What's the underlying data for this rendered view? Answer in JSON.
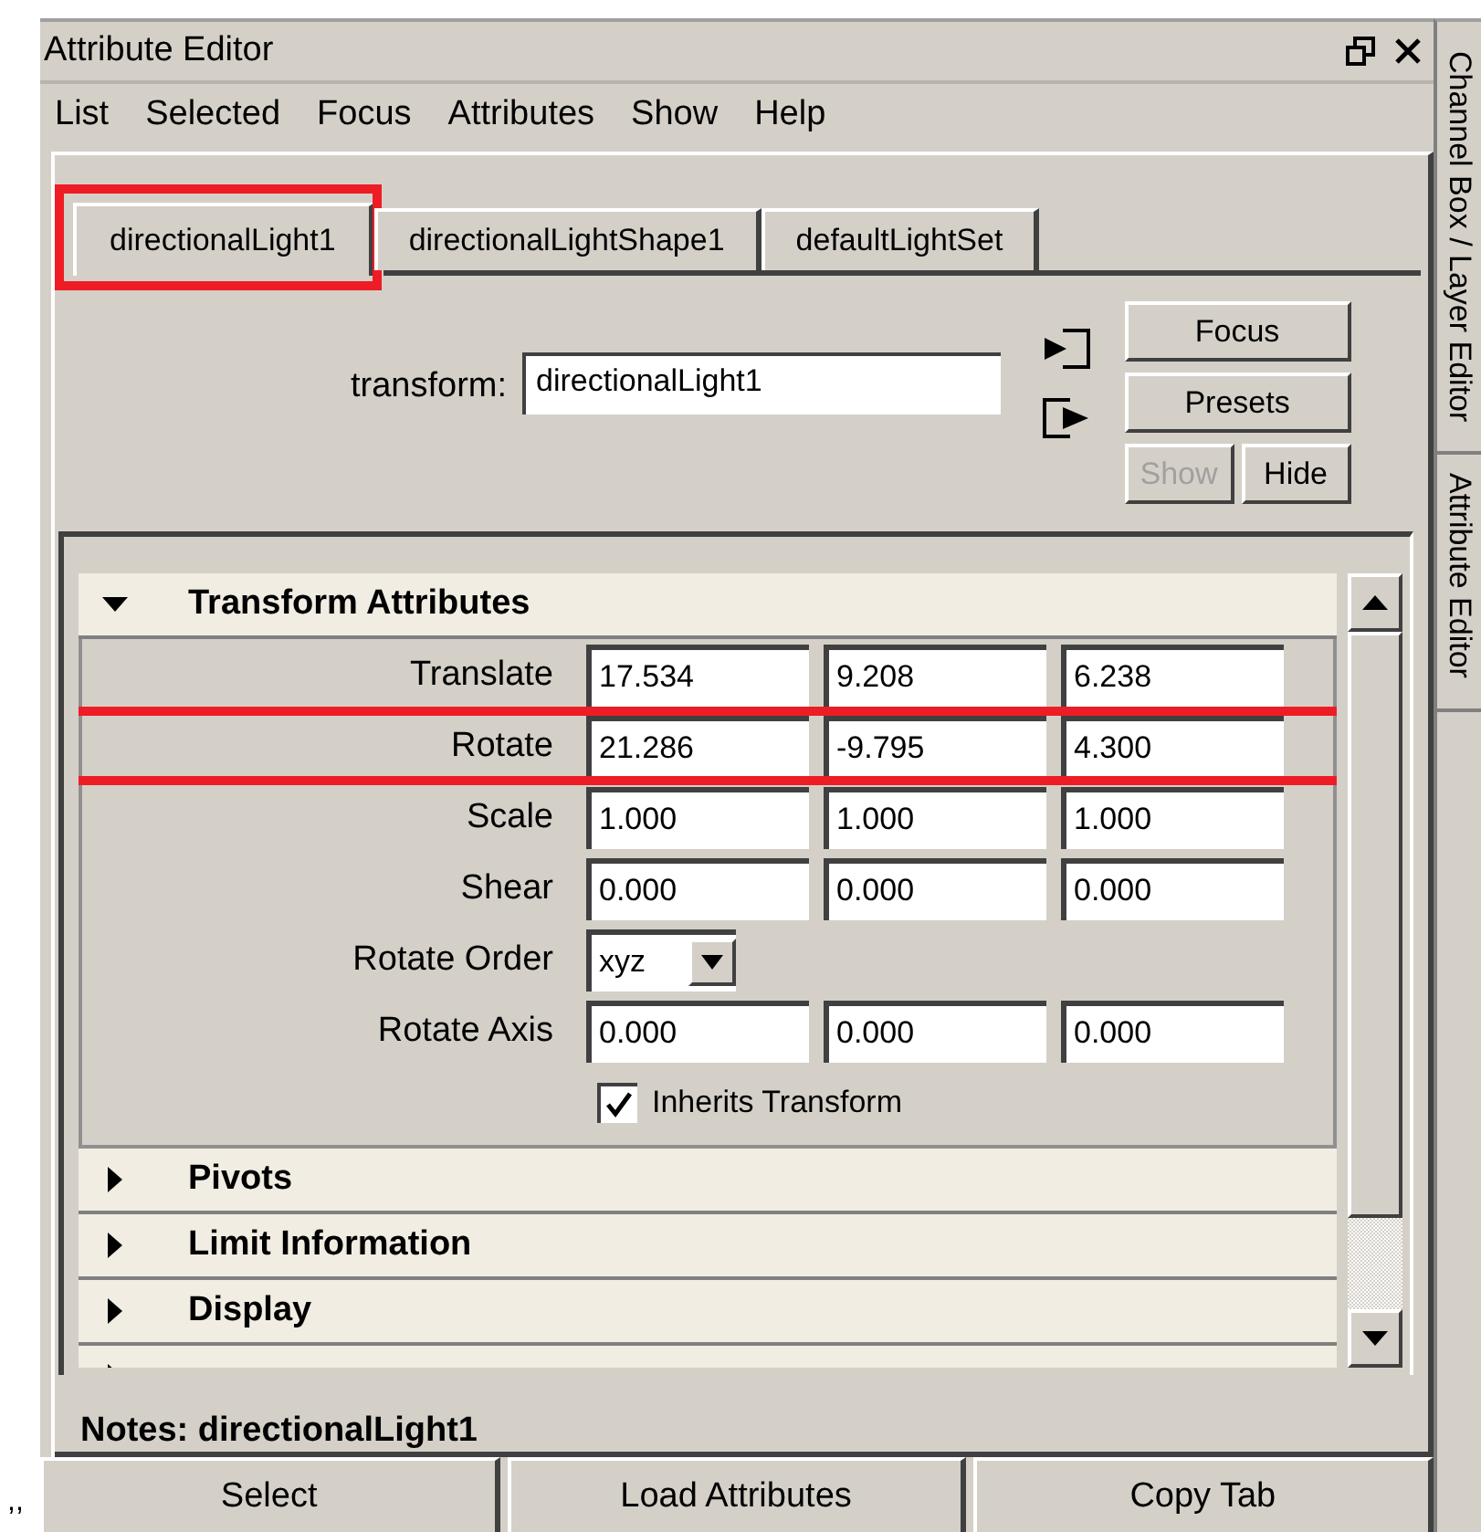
{
  "window": {
    "title": "Attribute Editor"
  },
  "menu": [
    "List",
    "Selected",
    "Focus",
    "Attributes",
    "Show",
    "Help"
  ],
  "tabs": [
    {
      "label": "directionalLight1",
      "selected": true,
      "highlighted": true
    },
    {
      "label": "directionalLightShape1",
      "selected": false,
      "highlighted": false
    },
    {
      "label": "defaultLightSet",
      "selected": false,
      "highlighted": false
    }
  ],
  "node": {
    "label": "transform:",
    "value": "directionalLight1"
  },
  "side_buttons": [
    {
      "label": "Focus",
      "disabled": false
    },
    {
      "label": "Presets",
      "disabled": false
    },
    {
      "label": "Show",
      "disabled": true
    },
    {
      "label": "Hide",
      "disabled": false
    }
  ],
  "sections": [
    {
      "title": "Transform Attributes",
      "expanded": true,
      "rows": [
        {
          "kind": "vector",
          "label": "Translate",
          "values": [
            "17.534",
            "9.208",
            "6.238"
          ],
          "highlighted": false
        },
        {
          "kind": "vector",
          "label": "Rotate",
          "values": [
            "21.286",
            "-9.795",
            "4.300"
          ],
          "highlighted": true
        },
        {
          "kind": "vector",
          "label": "Scale",
          "values": [
            "1.000",
            "1.000",
            "1.000"
          ],
          "highlighted": false
        },
        {
          "kind": "vector",
          "label": "Shear",
          "values": [
            "0.000",
            "0.000",
            "0.000"
          ],
          "highlighted": false
        },
        {
          "kind": "dropdown",
          "label": "Rotate Order",
          "value": "xyz",
          "highlighted": false
        },
        {
          "kind": "vector",
          "label": "Rotate Axis",
          "values": [
            "0.000",
            "0.000",
            "0.000"
          ],
          "highlighted": false
        },
        {
          "kind": "checkbox",
          "label": "Inherits Transform",
          "checked": true,
          "highlighted": false
        }
      ]
    },
    {
      "title": "Pivots",
      "expanded": false
    },
    {
      "title": "Limit Information",
      "expanded": false
    },
    {
      "title": "Display",
      "expanded": false
    },
    {
      "expanded": false
    }
  ],
  "notes": "Notes:  directionalLight1",
  "bottom_buttons": [
    "Select",
    "Load Attributes",
    "Copy Tab"
  ],
  "side_tabs": [
    "Channel Box / Layer Editor",
    "Attribute Editor"
  ],
  "margin_mark": ",,"
}
